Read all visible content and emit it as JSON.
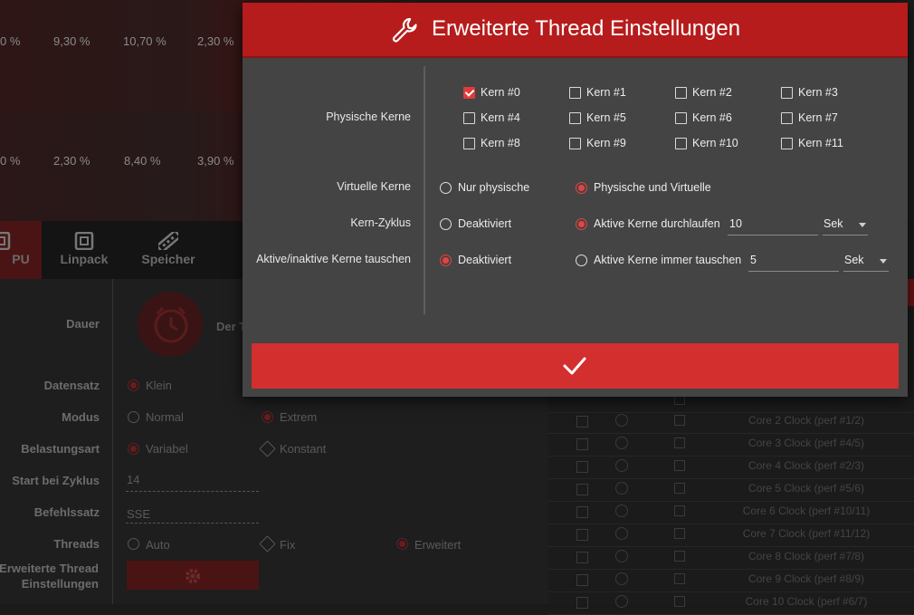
{
  "background": {
    "heat_row1": [
      "0 %",
      "9,30 %",
      "10,70 %",
      "2,30 %"
    ],
    "heat_row2": [
      "0 %",
      "2,30 %",
      "8,40 %",
      "3,90 %"
    ],
    "tabs": [
      {
        "label": "PU",
        "icon": "cpu-icon"
      },
      {
        "label": "Linpack",
        "icon": "chip-icon"
      },
      {
        "label": "Speicher",
        "icon": "memory-icon"
      }
    ],
    "fields": {
      "dauer_label": "Dauer",
      "dauer_value": "Der T",
      "datensatz_label": "Datensatz",
      "datensatz_option": "Klein",
      "modus_label": "Modus",
      "modus_normal": "Normal",
      "modus_extrem": "Extrem",
      "belastung_label": "Belastungsart",
      "belastung_variabel": "Variabel",
      "belastung_konstant": "Konstant",
      "start_label": "Start bei Zyklus",
      "start_value": "14",
      "befehl_label": "Befehlssatz",
      "befehl_value": "SSE",
      "threads_label": "Threads",
      "threads_auto": "Auto",
      "threads_fix": "Fix",
      "threads_erweitert": "Erweitert",
      "erweitert_label": "Erweiterte Thread Einstellungen"
    },
    "table_rows": [
      "Core 2 Clock (perf #1/2)",
      "Core 3 Clock (perf #4/5)",
      "Core 4 Clock (perf #2/3)",
      "Core 5 Clock (perf #5/6)",
      "Core 6 Clock (perf #10/11)",
      "Core 7 Clock (perf #11/12)",
      "Core 8 Clock (perf #7/8)",
      "Core 9 Clock (perf #8/9)",
      "Core 10 Clock (perf #6/7)"
    ]
  },
  "modal": {
    "title": "Erweiterte Thread Einstellungen",
    "title_icon": "wrench-icon",
    "physische_kerne_label": "Physische Kerne",
    "cores": [
      {
        "label": "Kern #0",
        "checked": true
      },
      {
        "label": "Kern #1",
        "checked": false
      },
      {
        "label": "Kern #2",
        "checked": false
      },
      {
        "label": "Kern #3",
        "checked": false
      },
      {
        "label": "Kern #4",
        "checked": false
      },
      {
        "label": "Kern #5",
        "checked": false
      },
      {
        "label": "Kern #6",
        "checked": false
      },
      {
        "label": "Kern #7",
        "checked": false
      },
      {
        "label": "Kern #8",
        "checked": false
      },
      {
        "label": "Kern #9",
        "checked": false
      },
      {
        "label": "Kern #10",
        "checked": false
      },
      {
        "label": "Kern #11",
        "checked": false
      }
    ],
    "virtuelle_label": "Virtuelle Kerne",
    "virtuelle_opt1": "Nur physische",
    "virtuelle_opt2": "Physische und Virtuelle",
    "zyklus_label": "Kern-Zyklus",
    "zyklus_opt1": "Deaktiviert",
    "zyklus_opt2": "Aktive Kerne durchlaufen",
    "zyklus_value": "10",
    "zyklus_unit": "Sek",
    "tauschen_label": "Aktive/inaktive Kerne tauschen",
    "tauschen_opt1": "Deaktiviert",
    "tauschen_opt2": "Aktive Kerne immer tauschen",
    "tauschen_value": "5",
    "tauschen_unit": "Sek",
    "confirm_icon": "checkmark-icon",
    "accent": "#d32f2f"
  }
}
